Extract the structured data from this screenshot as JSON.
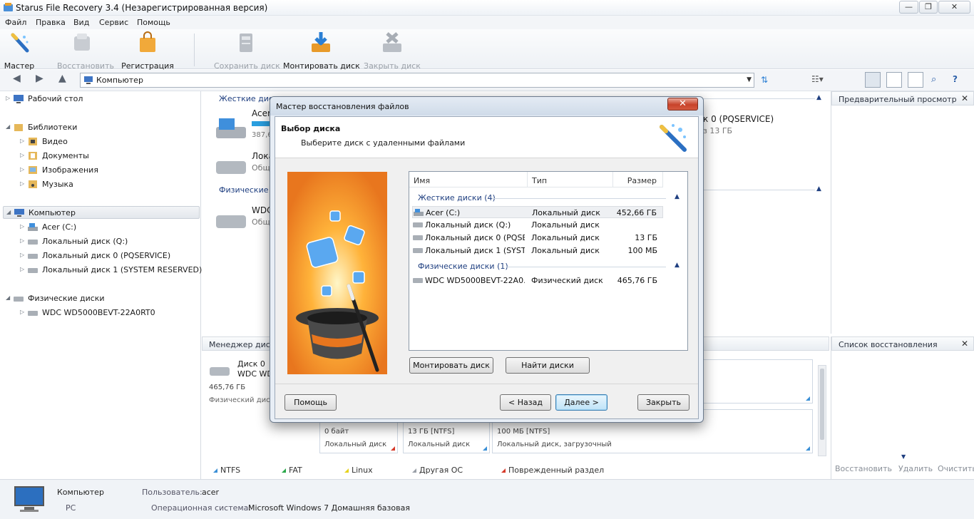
{
  "window": {
    "title": "Starus File Recovery 3.4 (Незарегистрированная версия)",
    "controls": {
      "minimize": "—",
      "maximize": "❐",
      "close": "✕"
    }
  },
  "menu": [
    "Файл",
    "Правка",
    "Вид",
    "Сервис",
    "Помощь"
  ],
  "toolbar": {
    "master": "Мастер",
    "restore": "Восстановить",
    "register": "Регистрация",
    "save_disk": "Сохранить диск",
    "mount_disk": "Монтировать диск",
    "close_disk": "Закрыть диск"
  },
  "address": {
    "value": "Компьютер"
  },
  "tree": {
    "desktop": "Рабочий стол",
    "libraries": "Библиотеки",
    "video": "Видео",
    "documents": "Документы",
    "images": "Изображения",
    "music": "Музыка",
    "computer": "Компьютер",
    "acer": "Acer (C:)",
    "disk_q": "Локальный диск (Q:)",
    "disk_0": "Локальный диск 0 (PQSERVICE)",
    "disk_1": "Локальный диск 1 (SYSTEM RESERVED)",
    "physical": "Физические диски",
    "wdc": "WDC WD5000BEVT-22A0RT0"
  },
  "main": {
    "hard_disks": "Жесткие дис",
    "acer": "Acer",
    "acer_size": "387,6",
    "local": "Локал",
    "local_sub": "Общ",
    "physical": "Физические д",
    "wdc": "WDC",
    "wdc_sub": "Общ",
    "right_disk": "к 0 (PQSERVICE)",
    "right_size": "з 13 ГБ"
  },
  "preview": {
    "title": "Предварительный просмотр",
    "close": "✕"
  },
  "manager": {
    "title": "Менеджер дис",
    "disk0": "Диск 0",
    "disk0_model": "WDC WD",
    "disk0_size": "465,76 ГБ",
    "disk0_type": "Физический диск",
    "p1_size": "0 байт",
    "p1_type": "Локальный диск",
    "p2_size": "13 ГБ [NTFS]",
    "p2_type": "Локальный диск",
    "p3_size": "100 МБ [NTFS]",
    "p3_type": "Локальный диск, загрузочный"
  },
  "legend": {
    "ntfs": "NTFS",
    "fat": "FAT",
    "linux": "Linux",
    "other": "Другая ОС",
    "damaged": "Поврежденный раздел"
  },
  "recovery_list": {
    "title": "Список восстановления",
    "close": "✕",
    "restore": "Восстановить",
    "delete": "Удалить",
    "clear": "Очистить"
  },
  "status": {
    "name": "Компьютер",
    "sub": "PC",
    "user_label": "Пользователь:",
    "user": "acer",
    "os_label": "Операционная система:",
    "os": "Microsoft Windows 7 Домашняя базовая"
  },
  "dialog": {
    "title": "Мастер восстановления файлов",
    "close": "✕",
    "heading": "Выбор диска",
    "subheading": "Выберите диск с удаленными файлами",
    "columns": {
      "name": "Имя",
      "type": "Тип",
      "size": "Размер"
    },
    "group_hard": "Жесткие диски (4)",
    "group_phys": "Физические диски (1)",
    "rows": [
      {
        "name": "Acer (C:)",
        "type": "Локальный диск",
        "size": "452,66 ГБ"
      },
      {
        "name": "Локальный диск (Q:)",
        "type": "Локальный диск",
        "size": ""
      },
      {
        "name": "Локальный диск 0 (PQSE...",
        "type": "Локальный диск",
        "size": "13 ГБ"
      },
      {
        "name": "Локальный диск 1 (SYST...",
        "type": "Локальный диск",
        "size": "100 МБ"
      }
    ],
    "phys_rows": [
      {
        "name": "WDC WD5000BEVT-22A0...",
        "type": "Физический диск",
        "size": "465,76 ГБ"
      }
    ],
    "btn_mount": "Монтировать диск",
    "btn_find": "Найти диски",
    "btn_help": "Помощь",
    "btn_back": "< Назад",
    "btn_next": "Далее >",
    "btn_close": "Закрыть"
  },
  "colors": {
    "accent": "#1f3f80",
    "ntfs": "#3a8fd6",
    "fat": "#2aa84a",
    "linux": "#e6d21c",
    "other": "#9aa0a8",
    "damaged": "#d63a2a"
  }
}
